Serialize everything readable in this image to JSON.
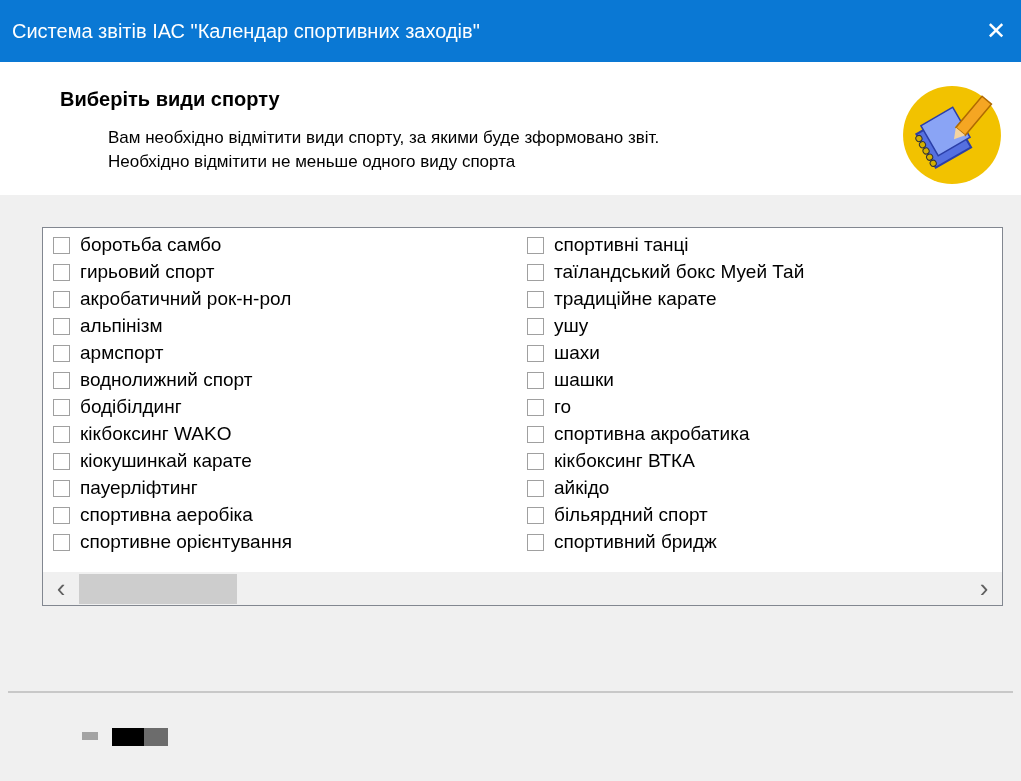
{
  "window": {
    "title": "Система звітів ІАС \"Календар спортивних заходів\"",
    "close": "✕"
  },
  "header": {
    "heading": "Виберіть види спорту",
    "description": [
      "Вам необхідно відмітити види спорту, за якими буде зформовано звіт.",
      "Необхідно відмітити не меньше одного виду спорта"
    ]
  },
  "sports": [
    [
      {
        "label": "боротьба самбо",
        "checked": false
      },
      {
        "label": "гирьовий спорт",
        "checked": false
      },
      {
        "label": "акробатичний рок-н-рол",
        "checked": false
      },
      {
        "label": "альпінізм",
        "checked": false
      },
      {
        "label": "армспорт",
        "checked": false
      },
      {
        "label": "воднолижний спорт",
        "checked": false
      },
      {
        "label": "бодібілдинг",
        "checked": false
      },
      {
        "label": "кікбоксинг WAKO",
        "checked": false
      },
      {
        "label": "кіокушинкай карате",
        "checked": false
      },
      {
        "label": "пауерліфтинг",
        "checked": false
      },
      {
        "label": "спортивна аеробіка",
        "checked": false
      },
      {
        "label": "спортивне орієнтування",
        "checked": false
      }
    ],
    [
      {
        "label": "спортивні танці",
        "checked": false
      },
      {
        "label": "таїландський бокс Муей Тай",
        "checked": false
      },
      {
        "label": "традиційне  карате",
        "checked": false
      },
      {
        "label": "ушу",
        "checked": false
      },
      {
        "label": "шахи",
        "checked": false
      },
      {
        "label": "шашки",
        "checked": false
      },
      {
        "label": "го",
        "checked": false
      },
      {
        "label": "спортивна акробатика",
        "checked": false
      },
      {
        "label": "кікбоксинг ВТКА",
        "checked": false
      },
      {
        "label": "айкідо",
        "checked": false
      },
      {
        "label": "більярдний спорт",
        "checked": false
      },
      {
        "label": "спортивний бридж",
        "checked": false
      }
    ]
  ],
  "scrollbar": {
    "left": "‹",
    "right": "›"
  }
}
